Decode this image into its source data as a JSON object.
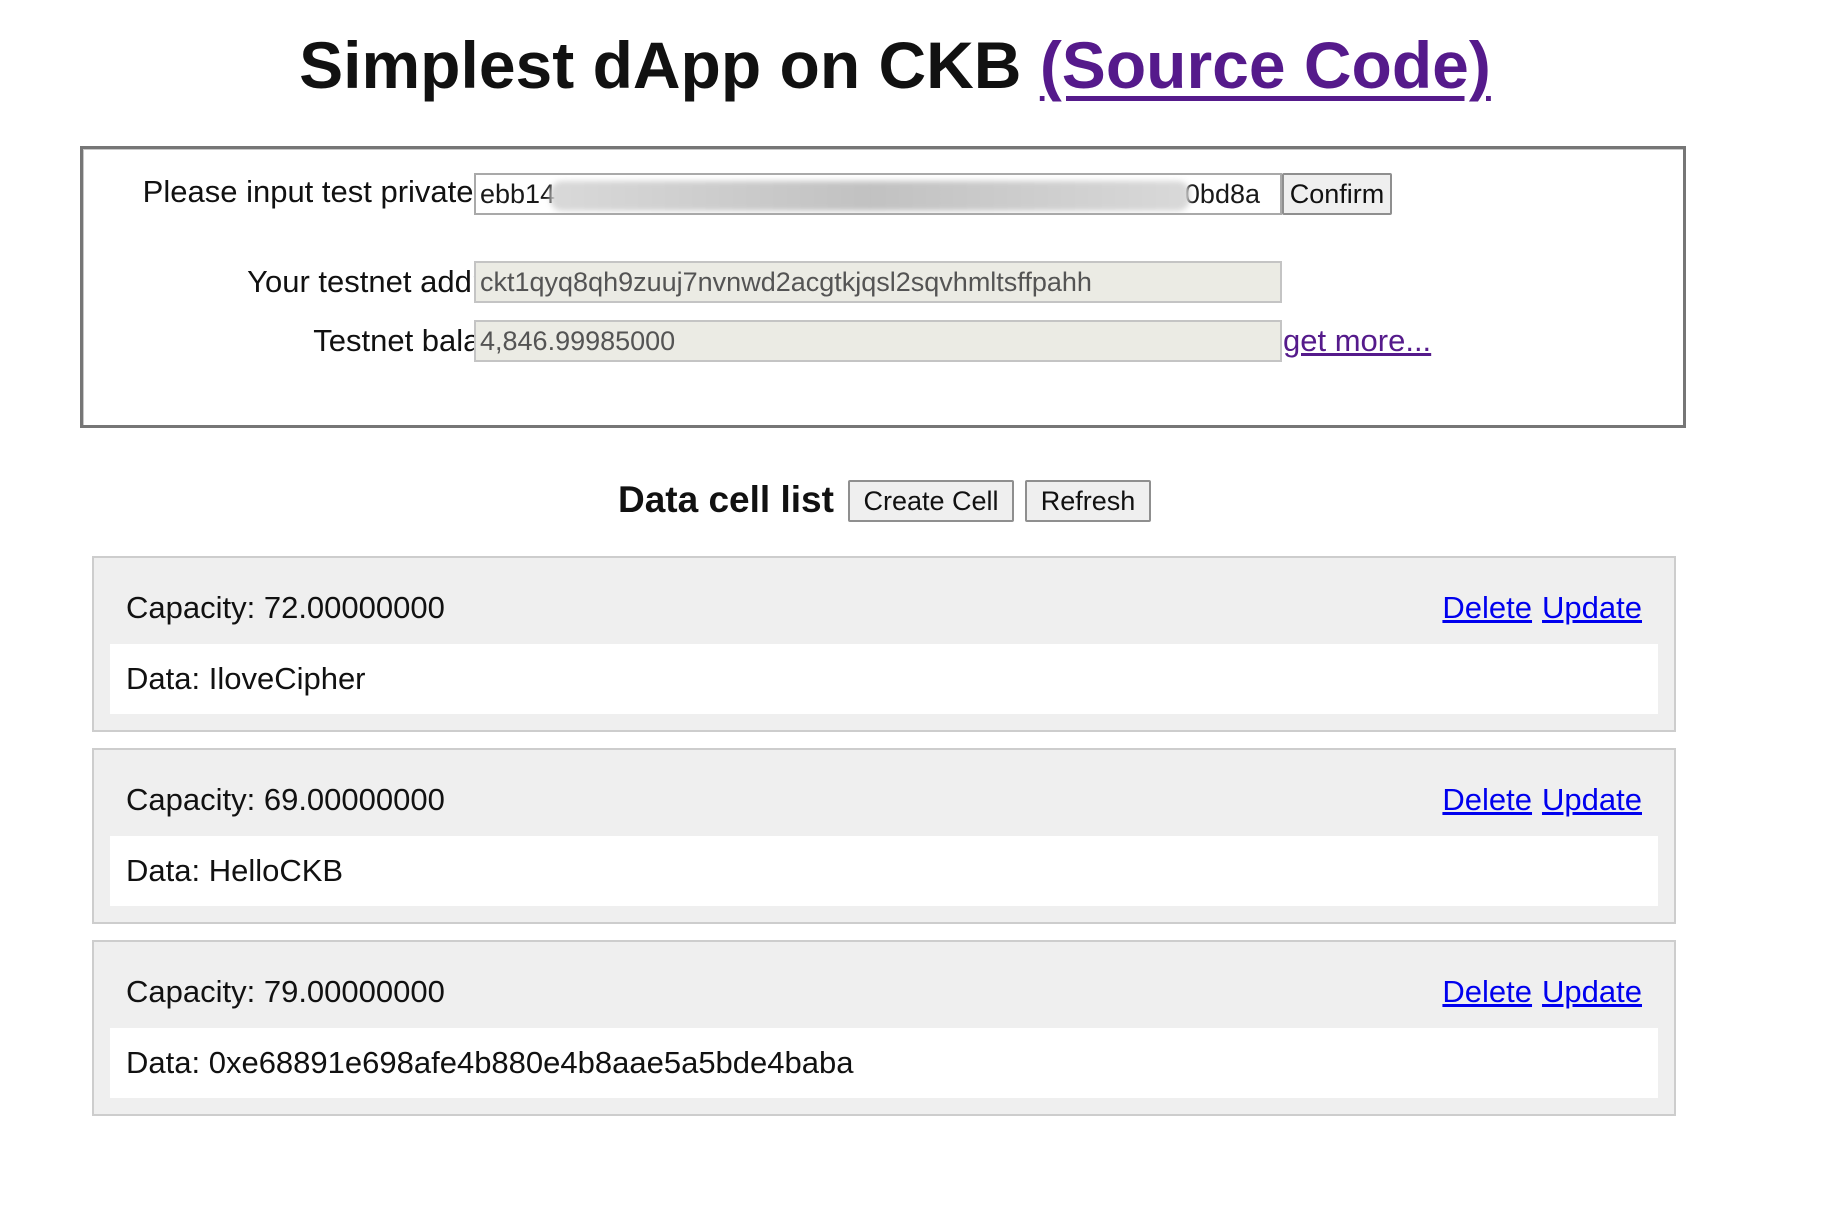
{
  "header": {
    "title": "Simplest dApp on CKB",
    "source_link": "(Source Code)"
  },
  "key_panel": {
    "private_key_label": "Please input test private key:",
    "private_key_start": "ebb14",
    "private_key_end": "0bd8a",
    "confirm_label": "Confirm",
    "address_label": "Your testnet address:",
    "address_value": "ckt1qyq8qh9zuuj7nvnwd2acgtkjqsl2sqvhmltsffpahh",
    "balance_label": "Testnet balance:",
    "balance_value": "4,846.99985000",
    "get_more_label": "get more..."
  },
  "cell_list": {
    "title": "Data cell list",
    "create_label": "Create Cell",
    "refresh_label": "Refresh",
    "delete_label": "Delete",
    "update_label": "Update",
    "cells": [
      {
        "capacity": "Capacity: 72.00000000",
        "data": "Data: IloveCipher"
      },
      {
        "capacity": "Capacity: 69.00000000",
        "data": "Data: HelloCKB"
      },
      {
        "capacity": "Capacity: 79.00000000",
        "data": "Data: 0xe68891e698afe4b880e4b8aae5a5bde4baba"
      }
    ]
  },
  "colors": {
    "visited_link": "#551a8b",
    "link": "#0000ee",
    "card_background": "#efefef",
    "readonly_field": "#ebebe4"
  }
}
